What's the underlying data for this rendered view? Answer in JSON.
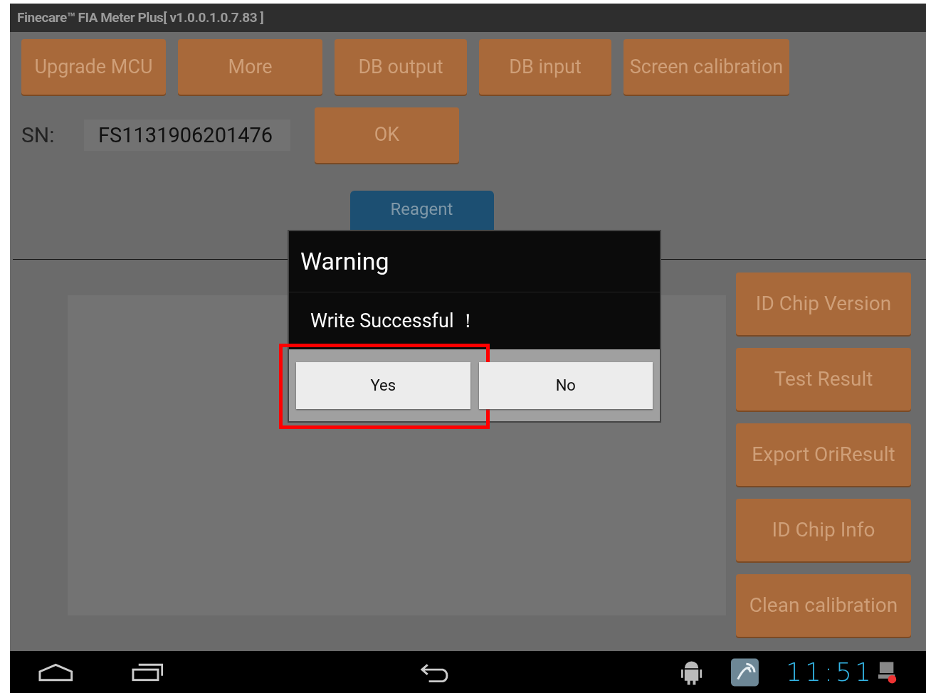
{
  "window": {
    "title": "Finecare™ FIA Meter Plus[ v1.0.0.1.0.7.83 ]"
  },
  "top_buttons": [
    "Upgrade MCU",
    "More",
    "DB output",
    "DB input",
    "Screen calibration"
  ],
  "sn": {
    "label": "SN:",
    "value": "FS1131906201476"
  },
  "ok_button": "OK",
  "reagent_button": "Reagent",
  "side_buttons": [
    "ID Chip Version",
    "Test Result",
    "Export OriResult",
    "ID Chip Info",
    "Clean calibration"
  ],
  "dialog": {
    "title": "Warning",
    "message": "Write Successful ！",
    "buttons": [
      {
        "label": "Yes",
        "highlighted": true
      },
      {
        "label": "No",
        "highlighted": false
      }
    ]
  },
  "status_bar": {
    "time": "11:51"
  }
}
